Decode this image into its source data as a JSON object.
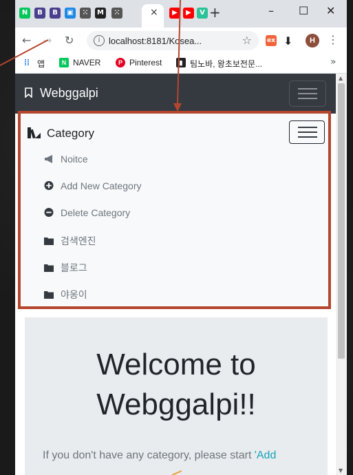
{
  "browser": {
    "tab_close": "×",
    "new_tab": "+",
    "url": "localhost:8181/Kosea...",
    "window_controls": [
      "–",
      "☐",
      "✕"
    ],
    "profile_initial": "H",
    "ext_label": "ex"
  },
  "bookmarks": [
    {
      "label": "앱",
      "icon": "apps-icon"
    },
    {
      "label": "NAVER",
      "icon": "naver-icon",
      "color": "#03c75a"
    },
    {
      "label": "Pinterest",
      "icon": "pinterest-icon",
      "color": "#e60023"
    },
    {
      "label": "팀노바, 왕초보전문...",
      "icon": "teamnova-icon"
    }
  ],
  "navbar": {
    "brand": "Webggalpi"
  },
  "sidebar": {
    "title": "Category",
    "items": [
      {
        "label": "Noitce",
        "icon": "bullhorn-icon"
      },
      {
        "label": "Add New Category",
        "icon": "plus-circle-icon"
      },
      {
        "label": "Delete Category",
        "icon": "minus-circle-icon"
      },
      {
        "label": "검색엔진",
        "icon": "folder-icon"
      },
      {
        "label": "블로그",
        "icon": "folder-icon"
      },
      {
        "label": "야옹이",
        "icon": "folder-icon"
      }
    ]
  },
  "jumbotron": {
    "title_line1": "Welcome to",
    "title_line2": "Webggalpi!!",
    "text_prefix": "If you don't have any category, please start ",
    "text_link": "'Add"
  },
  "colors": {
    "highlight": "#b5462e",
    "navbar": "#343a40",
    "link": "#17a2b8"
  }
}
